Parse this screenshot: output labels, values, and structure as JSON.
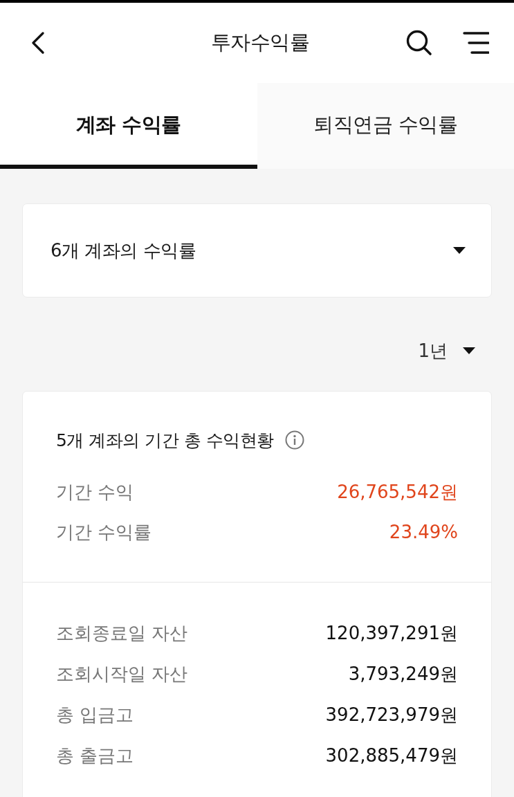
{
  "header": {
    "title": "투자수익률"
  },
  "tabs": [
    {
      "label": "계좌 수익률",
      "selected": true
    },
    {
      "label": "퇴직연금 수익률",
      "selected": false
    }
  ],
  "account_selector": {
    "label": "6개 계좌의 수익률"
  },
  "period_selector": {
    "value": "1년"
  },
  "summary": {
    "title": "5개 계좌의 기간 총 수익현황",
    "highlights": [
      {
        "label": "기간 수익",
        "value": "26,765,542원"
      },
      {
        "label": "기간 수익률",
        "value": "23.49%"
      }
    ],
    "details": [
      {
        "label": "조회종료일 자산",
        "value": "120,397,291원"
      },
      {
        "label": "조회시작일 자산",
        "value": "3,793,249원"
      },
      {
        "label": "총 입금고",
        "value": "392,723,979원"
      },
      {
        "label": "총 출금고",
        "value": "302,885,479원"
      }
    ]
  }
}
